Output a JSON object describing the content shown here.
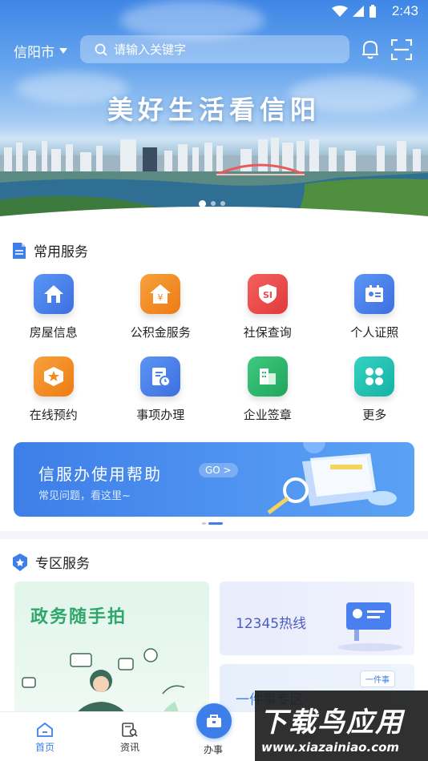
{
  "status_bar": {
    "time": "2:43"
  },
  "header": {
    "city": "信阳市",
    "search_placeholder": "请输入关键字",
    "slogan": "美好生活看信阳"
  },
  "common_services": {
    "title": "常用服务",
    "items": [
      {
        "label": "房屋信息",
        "icon": "house-icon",
        "color": "#4a7ff0"
      },
      {
        "label": "公积金服务",
        "icon": "fund-house-icon",
        "color": "#f28a1e"
      },
      {
        "label": "社保查询",
        "icon": "social-security-icon",
        "color": "#ef4a4a"
      },
      {
        "label": "个人证照",
        "icon": "id-card-icon",
        "color": "#4a7ff0"
      },
      {
        "label": "在线预约",
        "icon": "star-appointment-icon",
        "color": "#f28a1e"
      },
      {
        "label": "事项办理",
        "icon": "document-clock-icon",
        "color": "#4a7ff0"
      },
      {
        "label": "企业签章",
        "icon": "enterprise-building-icon",
        "color": "#27b26b"
      },
      {
        "label": "更多",
        "icon": "more-grid-icon",
        "color": "#22c2b4"
      }
    ]
  },
  "help_banner": {
    "title": "信服办使用帮助",
    "go": "GO >",
    "subtitle": "常见问题，看这里~"
  },
  "zone_services": {
    "title": "专区服务",
    "cards": [
      {
        "label": "政务随手拍"
      },
      {
        "label": "12345热线"
      },
      {
        "label": "一件事专区",
        "tag": "一件事"
      }
    ]
  },
  "tabbar": {
    "tabs": [
      {
        "label": "首页"
      },
      {
        "label": "资讯"
      },
      {
        "label": "办事"
      }
    ]
  },
  "watermark": {
    "line1": "下载鸟应用",
    "line2": "www.xiazainiao.com"
  }
}
